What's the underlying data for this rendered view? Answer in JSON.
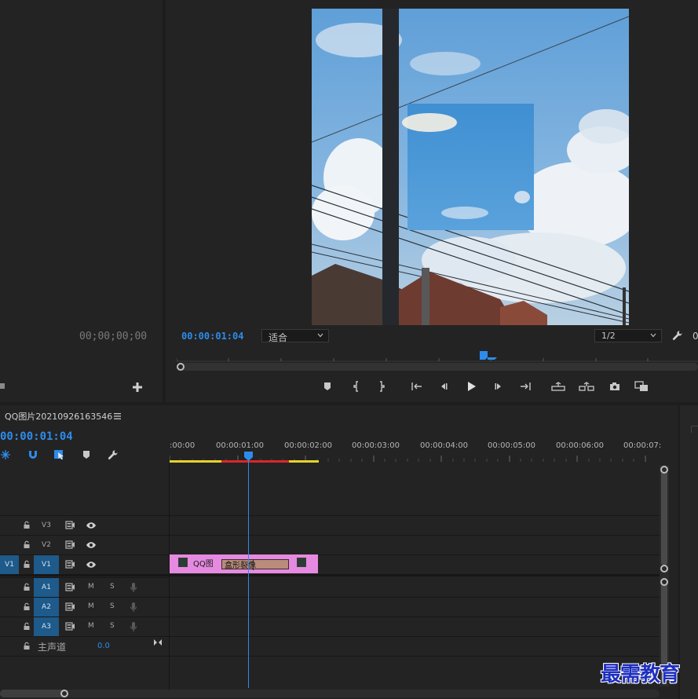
{
  "source_monitor": {
    "timecode": "00;00;00;00"
  },
  "program_monitor": {
    "timecode": "00:00:01:04",
    "fit_select": "适合",
    "resolution_select": "1/2",
    "trailing_value": "0",
    "playhead_position": 0.61
  },
  "timeline": {
    "sequence_name": "QQ图片20210926163546",
    "timecode": "00:00:01:04",
    "ruler_labels": [
      ":00:00",
      "00:00:01:00",
      "00:00:02:00",
      "00:00:03:00",
      "00:00:04:00",
      "00:00:05:00",
      "00:00:06:00",
      "00:00:07:"
    ],
    "video_tracks": [
      {
        "name": "V3",
        "source": ""
      },
      {
        "name": "V2",
        "source": ""
      },
      {
        "name": "V1",
        "source": "V1"
      }
    ],
    "audio_tracks": [
      {
        "name": "A1"
      },
      {
        "name": "A2"
      },
      {
        "name": "A3"
      }
    ],
    "audio_buttons": {
      "mute": "M",
      "solo": "S"
    },
    "master": {
      "label": "主声道",
      "value": "0.0"
    },
    "clip": {
      "name": "QQ图",
      "effect": "盒形裂像",
      "fx_badge": "fx",
      "color": "#e58ae0"
    }
  },
  "watermark": {
    "text": "最需教育"
  }
}
